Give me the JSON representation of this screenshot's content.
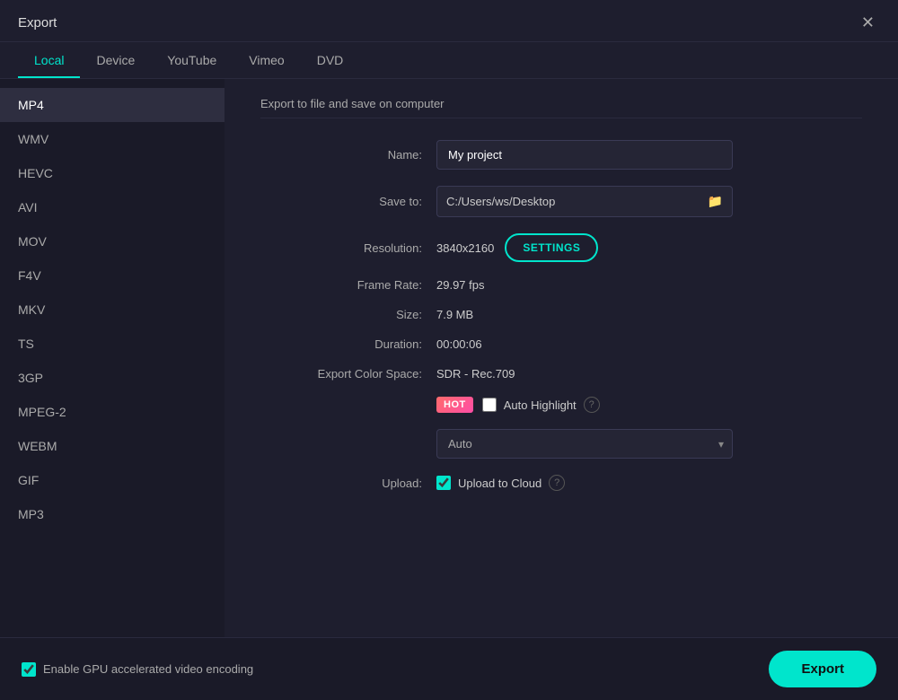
{
  "dialog": {
    "title": "Export",
    "close_label": "✕"
  },
  "tabs": [
    {
      "id": "local",
      "label": "Local",
      "active": true
    },
    {
      "id": "device",
      "label": "Device",
      "active": false
    },
    {
      "id": "youtube",
      "label": "YouTube",
      "active": false
    },
    {
      "id": "vimeo",
      "label": "Vimeo",
      "active": false
    },
    {
      "id": "dvd",
      "label": "DVD",
      "active": false
    }
  ],
  "sidebar": {
    "items": [
      {
        "id": "mp4",
        "label": "MP4",
        "active": true
      },
      {
        "id": "wmv",
        "label": "WMV",
        "active": false
      },
      {
        "id": "hevc",
        "label": "HEVC",
        "active": false
      },
      {
        "id": "avi",
        "label": "AVI",
        "active": false
      },
      {
        "id": "mov",
        "label": "MOV",
        "active": false
      },
      {
        "id": "f4v",
        "label": "F4V",
        "active": false
      },
      {
        "id": "mkv",
        "label": "MKV",
        "active": false
      },
      {
        "id": "ts",
        "label": "TS",
        "active": false
      },
      {
        "id": "3gp",
        "label": "3GP",
        "active": false
      },
      {
        "id": "mpeg2",
        "label": "MPEG-2",
        "active": false
      },
      {
        "id": "webm",
        "label": "WEBM",
        "active": false
      },
      {
        "id": "gif",
        "label": "GIF",
        "active": false
      },
      {
        "id": "mp3",
        "label": "MP3",
        "active": false
      }
    ]
  },
  "panel": {
    "section_title": "Export to file and save on computer",
    "name_label": "Name:",
    "name_value": "My project",
    "save_to_label": "Save to:",
    "save_to_value": "C:/Users/ws/Desktop",
    "resolution_label": "Resolution:",
    "resolution_value": "3840x2160",
    "settings_label": "SETTINGS",
    "frame_rate_label": "Frame Rate:",
    "frame_rate_value": "29.97 fps",
    "size_label": "Size:",
    "size_value": "7.9 MB",
    "duration_label": "Duration:",
    "duration_value": "00:00:06",
    "export_color_label": "Export Color Space:",
    "export_color_value": "SDR - Rec.709",
    "hot_badge": "HOT",
    "auto_highlight_label": "Auto Highlight",
    "auto_highlight_help": "?",
    "auto_dropdown_value": "Auto",
    "upload_label": "Upload:",
    "upload_to_cloud_label": "Upload to Cloud",
    "upload_help": "?"
  },
  "footer": {
    "gpu_label": "Enable GPU accelerated video encoding",
    "export_label": "Export"
  },
  "icons": {
    "folder": "🗁",
    "chevron_down": "▾"
  }
}
